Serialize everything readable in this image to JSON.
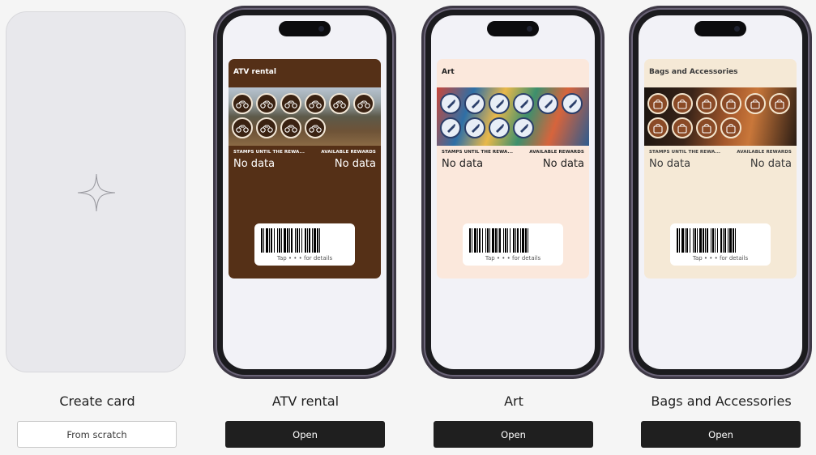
{
  "create": {
    "title": "Create card",
    "button_label": "From scratch"
  },
  "templates": [
    {
      "name": "ATV rental",
      "button_label": "Open",
      "pass": {
        "title": "ATV rental",
        "left_label": "STAMPS UNTIL THE REWA...",
        "left_value": "No data",
        "right_label": "AVAILABLE REWARDS",
        "right_value": "No data",
        "tap_text": "Tap • • • for details",
        "bg_color": "#553017",
        "text_color": "#ffffff",
        "stamp_icon": "atv-icon"
      }
    },
    {
      "name": "Art",
      "button_label": "Open",
      "pass": {
        "title": "Art",
        "left_label": "STAMPS UNTIL THE REWA...",
        "left_value": "No data",
        "right_label": "AVAILABLE REWARDS",
        "right_value": "No data",
        "tap_text": "Tap • • • for details",
        "bg_color": "#fbe8dc",
        "text_color": "#222222",
        "stamp_icon": "paintbrush-icon"
      }
    },
    {
      "name": "Bags and Accessories",
      "button_label": "Open",
      "pass": {
        "title": "Bags and Accessories",
        "left_label": "STAMPS UNTIL THE REWA...",
        "left_value": "No data",
        "right_label": "AVAILABLE REWARDS",
        "right_value": "No data",
        "tap_text": "Tap • • • for details",
        "bg_color": "#f5e9d6",
        "text_color": "#3a3a3a",
        "stamp_icon": "handbag-icon"
      }
    }
  ]
}
